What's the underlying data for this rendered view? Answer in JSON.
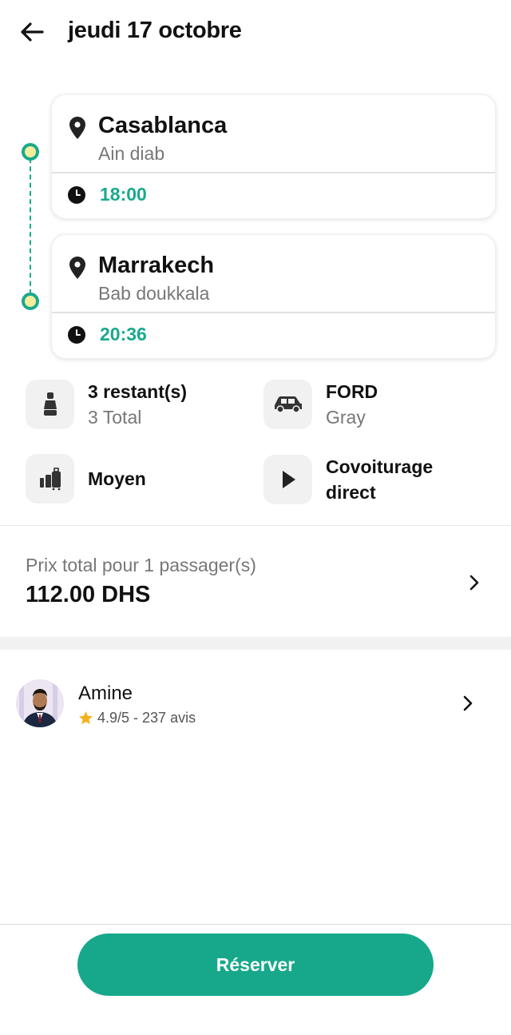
{
  "header": {
    "title": "jeudi 17 octobre"
  },
  "trip": {
    "departure": {
      "city": "Casablanca",
      "place": "Ain diab",
      "time": "18:00"
    },
    "arrival": {
      "city": "Marrakech",
      "place": "Bab doukkala",
      "time": "20:36"
    }
  },
  "info": {
    "seats": {
      "main": "3 restant(s)",
      "sub": "3 Total"
    },
    "car": {
      "main": "FORD",
      "sub": "Gray"
    },
    "luggage": {
      "main": "Moyen"
    },
    "ride_type": {
      "main": "Covoiturage direct"
    }
  },
  "price": {
    "label": "Prix total pour 1 passager(s)",
    "value": "112.00 DHS"
  },
  "driver": {
    "name": "Amine",
    "rating": "4.9/5 - 237 avis"
  },
  "actions": {
    "reserve_label": "Réserver"
  },
  "colors": {
    "accent": "#17a88c",
    "dot_fill": "#f4ed9c",
    "star": "#f2b21b"
  },
  "icons": [
    "back-arrow-icon",
    "location-pin-icon",
    "clock-icon",
    "seat-icon",
    "car-icon",
    "luggage-icon",
    "play-icon",
    "chevron-right-icon",
    "star-icon"
  ]
}
